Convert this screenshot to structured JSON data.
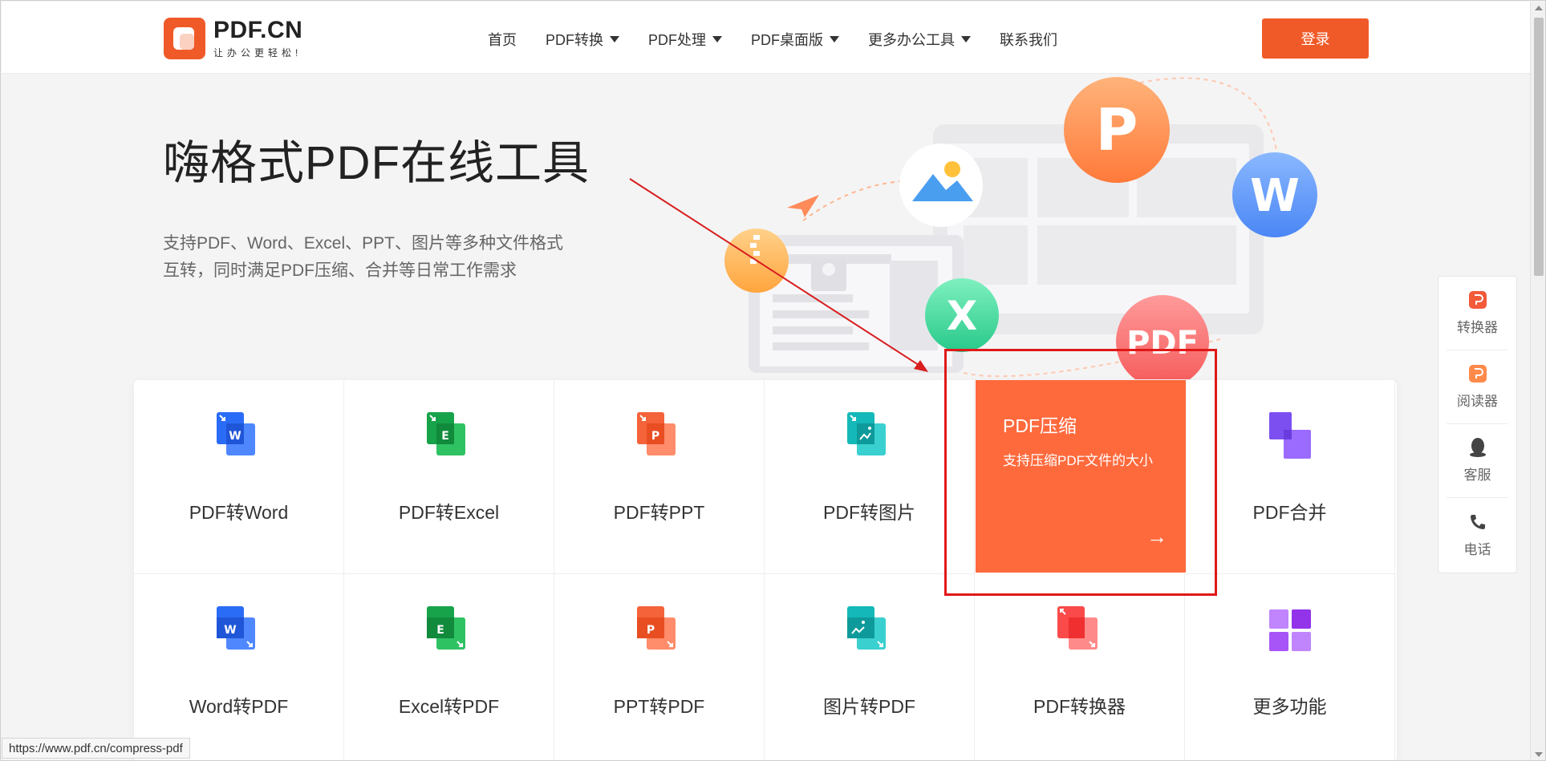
{
  "header": {
    "logo_text": "PDF.CN",
    "logo_slogan": "让办公更轻松!",
    "nav": [
      {
        "label": "首页",
        "dropdown": false
      },
      {
        "label": "PDF转换",
        "dropdown": true
      },
      {
        "label": "PDF处理",
        "dropdown": true
      },
      {
        "label": "PDF桌面版",
        "dropdown": true
      },
      {
        "label": "更多办公工具",
        "dropdown": true
      },
      {
        "label": "联系我们",
        "dropdown": false
      }
    ],
    "login_label": "登录"
  },
  "hero": {
    "title": "嗨格式PDF在线工具",
    "desc_line1": "支持PDF、Word、Excel、PPT、图片等多种文件格式",
    "desc_line2": "互转，同时满足PDF压缩、合并等日常工作需求"
  },
  "illustration": {
    "bubble_p": "P",
    "bubble_w": "W",
    "bubble_x": "X",
    "bubble_pdf": "PDF"
  },
  "tools": [
    {
      "label": "PDF转Word",
      "icon": "word-icon",
      "color": "#2b6cf6",
      "letter": "W"
    },
    {
      "label": "PDF转Excel",
      "icon": "excel-icon",
      "color": "#17a34a",
      "letter": "E"
    },
    {
      "label": "PDF转PPT",
      "icon": "ppt-icon",
      "color": "#f4633a",
      "letter": "P"
    },
    {
      "label": "PDF转图片",
      "icon": "image-icon",
      "color": "#14b8b8",
      "letter": ""
    },
    {
      "label": "PDF压缩",
      "icon": "compress-icon",
      "color": "#ff6a3d",
      "letter": ""
    },
    {
      "label": "PDF合并",
      "icon": "merge-icon",
      "color": "#8b5cf6",
      "letter": ""
    },
    {
      "label": "Word转PDF",
      "icon": "word-icon",
      "color": "#2b6cf6",
      "letter": "W"
    },
    {
      "label": "Excel转PDF",
      "icon": "excel-icon",
      "color": "#17a34a",
      "letter": "E"
    },
    {
      "label": "PPT转PDF",
      "icon": "ppt-icon",
      "color": "#f4633a",
      "letter": "P"
    },
    {
      "label": "图片转PDF",
      "icon": "image-icon",
      "color": "#14b8b8",
      "letter": ""
    },
    {
      "label": "PDF转换器",
      "icon": "converter-icon",
      "color": "#fb4a4a",
      "letter": ""
    },
    {
      "label": "更多功能",
      "icon": "grid-icon",
      "color": "#a855f7",
      "letter": ""
    }
  ],
  "highlight": {
    "title": "PDF压缩",
    "desc": "支持压缩PDF文件的大小",
    "arrow": "→"
  },
  "sidebar": [
    {
      "label": "转换器",
      "icon": "converter-app-icon"
    },
    {
      "label": "阅读器",
      "icon": "reader-app-icon"
    },
    {
      "label": "客服",
      "icon": "qq-icon"
    },
    {
      "label": "电话",
      "icon": "phone-icon"
    }
  ],
  "status_url": "https://www.pdf.cn/compress-pdf"
}
